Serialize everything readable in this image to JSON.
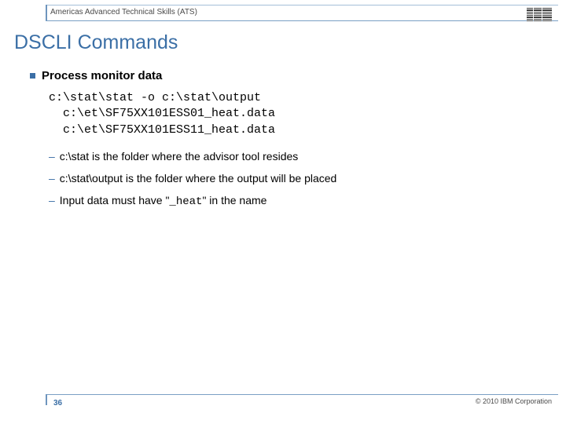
{
  "header": {
    "breadcrumb": "Americas Advanced Technical Skills (ATS)",
    "logo_name": "IBM"
  },
  "title": "DSCLI Commands",
  "content": {
    "bullet": "Process monitor data",
    "code": {
      "l1": "c:\\stat\\stat -o c:\\stat\\output",
      "l2": "  c:\\et\\SF75XX101ESS01_heat.data",
      "l3": "  c:\\et\\SF75XX101ESS11_heat.data"
    },
    "subs": {
      "s1": "c:\\stat is the folder where the advisor tool resides",
      "s2": "c:\\stat\\output is the folder where the output will be placed",
      "s3_pre": "Input data must have \"",
      "s3_mono": "_heat",
      "s3_post": "\" in the name"
    }
  },
  "footer": {
    "page": "36",
    "copyright": "© 2010 IBM Corporation"
  }
}
